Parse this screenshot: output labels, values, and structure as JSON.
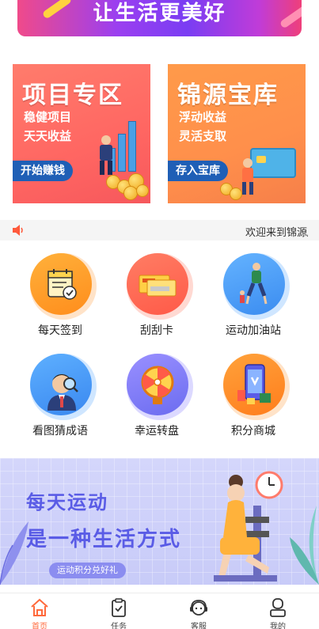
{
  "top_banner": {
    "slogan": "让生活更美好"
  },
  "promo": [
    {
      "title": "项目专区",
      "sub1": "稳健项目",
      "sub2": "天天收益",
      "button": "开始赚钱"
    },
    {
      "title": "锦源宝库",
      "sub1": "浮动收益",
      "sub2": "灵活支取",
      "button": "存入宝库"
    }
  ],
  "notice": {
    "text": "欢迎来到锦源/"
  },
  "features": [
    {
      "label": "每天签到",
      "icon": "calendar-check-icon"
    },
    {
      "label": "刮刮卡",
      "icon": "scratch-card-icon"
    },
    {
      "label": "运动加油站",
      "icon": "runner-icon"
    },
    {
      "label": "看图猜成语",
      "icon": "magnifier-man-icon"
    },
    {
      "label": "幸运转盘",
      "icon": "lucky-wheel-icon"
    },
    {
      "label": "积分商城",
      "icon": "shopping-phone-icon"
    }
  ],
  "sport_banner": {
    "line1": "每天运动",
    "line2": "是一种生活方式",
    "tag": "运动积分兑好礼"
  },
  "tabbar": [
    {
      "label": "首页",
      "icon": "home-icon",
      "active": true
    },
    {
      "label": "任务",
      "icon": "clipboard-icon",
      "active": false
    },
    {
      "label": "客服",
      "icon": "support-icon",
      "active": false
    },
    {
      "label": "我的",
      "icon": "user-icon",
      "active": false
    }
  ],
  "colors": {
    "accent": "#ff6a3c",
    "promo_left": "#ff6a64",
    "promo_right": "#ff9150",
    "banner_purple": "#5a5ce6",
    "button_blue": "#1f5fb6"
  }
}
